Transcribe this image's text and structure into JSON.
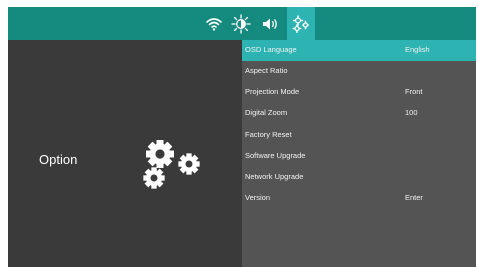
{
  "top_tabs": [
    {
      "icon": "wifi-icon",
      "active": false
    },
    {
      "icon": "brightness-icon",
      "active": false
    },
    {
      "icon": "speaker-icon",
      "active": false
    },
    {
      "icon": "gears-icon",
      "active": true
    }
  ],
  "left_panel": {
    "title": "Option",
    "icon": "gears-icon"
  },
  "menu": {
    "items": [
      {
        "label": "OSD Language",
        "value": "English",
        "selected": true
      },
      {
        "label": "Aspect Ratio",
        "value": ""
      },
      {
        "label": "Projection Mode",
        "value": "Front"
      },
      {
        "label": "Digital Zoom",
        "value": "100"
      },
      {
        "label": "Factory Reset",
        "value": ""
      },
      {
        "label": "Software Upgrade",
        "value": ""
      },
      {
        "label": "Network Upgrade",
        "value": ""
      },
      {
        "label": "Version",
        "value": "Enter"
      }
    ]
  },
  "colors": {
    "topbar": "#158b80",
    "accent": "#2db3b1",
    "left_bg": "#3a3a3a",
    "menu_bg": "#545454",
    "text": "#ffffff"
  }
}
